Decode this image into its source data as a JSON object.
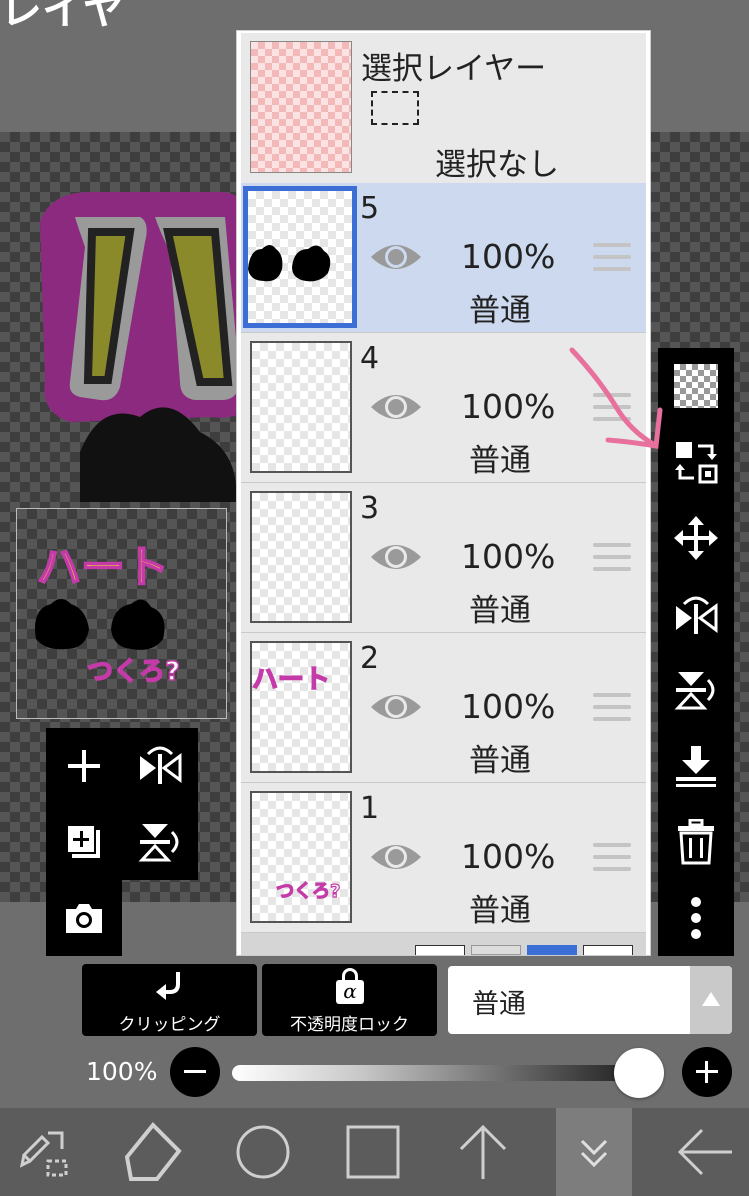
{
  "header": {
    "title_partial": "レイヤ"
  },
  "selection_layer": {
    "title": "選択レイヤー",
    "status": "選択なし"
  },
  "layers": [
    {
      "number": "5",
      "opacity": "100%",
      "mode": "普通",
      "selected": true
    },
    {
      "number": "4",
      "opacity": "100%",
      "mode": "普通",
      "selected": false
    },
    {
      "number": "3",
      "opacity": "100%",
      "mode": "普通",
      "selected": false
    },
    {
      "number": "2",
      "opacity": "100%",
      "mode": "普通",
      "selected": false,
      "thumb_text": "ハート"
    },
    {
      "number": "1",
      "opacity": "100%",
      "mode": "普通",
      "selected": false,
      "thumb_text": "つくろ?"
    }
  ],
  "preview": {
    "title_text": "ハート",
    "sub_text": "つくろ?"
  },
  "bottom": {
    "clipping_label": "クリッピング",
    "alpha_lock_label": "不透明度ロック",
    "alpha_symbol": "α",
    "blend_mode": "普通",
    "opacity_value": "100%",
    "opacity_fraction": 1.0
  },
  "icons": {
    "right_toolbar": [
      "transparent-checker-icon",
      "swap-layer-icon",
      "move-icon",
      "flip-horizontal-icon",
      "flip-vertical-icon",
      "merge-down-icon",
      "trash-icon",
      "more-icon"
    ],
    "left_toolbar": [
      "add-layer-icon",
      "flip-horizontal-icon",
      "copy-layer-icon",
      "flip-vertical-icon",
      "camera-icon"
    ],
    "bottom_toolbar": [
      "pen-select-icon",
      "lasso-icon",
      "ellipse-icon",
      "rectangle-icon",
      "arrow-up-icon",
      "chevron-down-icon",
      "arrow-left-icon"
    ]
  },
  "colors": {
    "selected_row": "#ccd9ee",
    "selected_border": "#3b6fd6",
    "annotation": "#e8709c",
    "title_yellow": "#f5f028",
    "title_outline": "#c43aa8"
  }
}
